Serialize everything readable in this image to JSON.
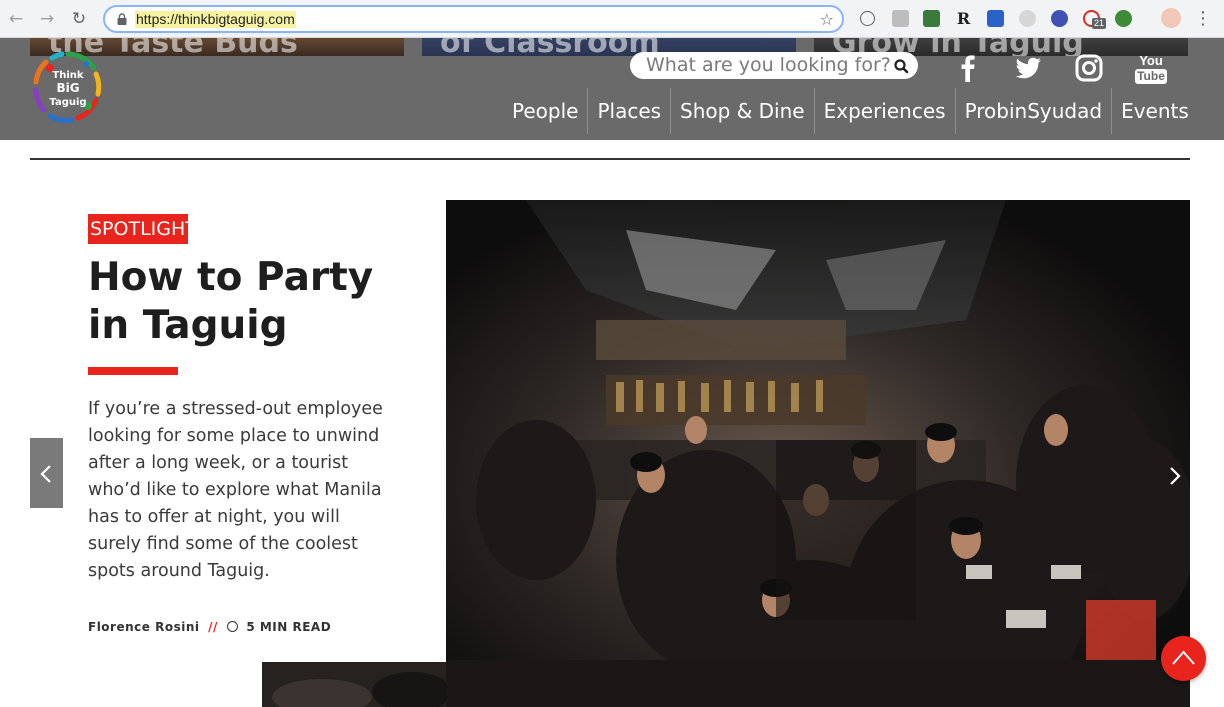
{
  "browser": {
    "url": "https://thinkbigtaguig.com",
    "extensions_badge_count": "21",
    "extension_r_label": "R"
  },
  "header": {
    "teasers": [
      "the Taste Buds",
      "of Classroom",
      "Grow in Taguig"
    ],
    "logo_lines": [
      "Think",
      "BiG",
      "Taguig"
    ],
    "search_placeholder": "What are you looking for?",
    "social": [
      {
        "name": "facebook-icon",
        "glyph": "f"
      },
      {
        "name": "twitter-icon",
        "glyph": "twitter"
      },
      {
        "name": "instagram-icon",
        "glyph": "instagram"
      },
      {
        "name": "youtube-icon",
        "glyph": "You Tube"
      }
    ],
    "youtube_top": "You",
    "youtube_bottom": "Tube",
    "nav": [
      "People",
      "Places",
      "Shop & Dine",
      "Experiences",
      "ProbinSyudad",
      "Events"
    ]
  },
  "feature": {
    "badge": "SPOTLIGHT",
    "title": "How to Party in Taguig",
    "excerpt": "If you’re a stressed-out employee looking for some place to unwind after a long week, or a tourist who’d like to explore what Manila has to offer at night, you will surely find some of the coolest spots around Taguig.",
    "author": "Florence Rosini",
    "separator": "//",
    "read_time": "5 MIN READ"
  },
  "colors": {
    "accent": "#e8241c",
    "header_bg": "#6a6a6a"
  }
}
